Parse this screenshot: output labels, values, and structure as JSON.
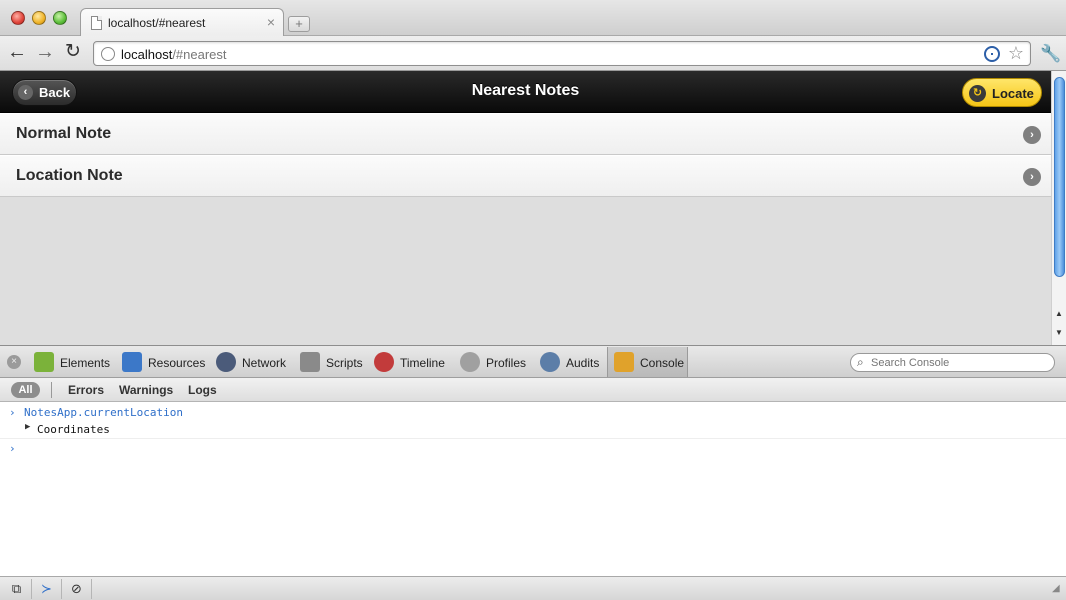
{
  "browser": {
    "tab_title": "localhost/#nearest",
    "tab_close": "×",
    "new_tab": "+",
    "url_host": "localhost",
    "url_path": "/#nearest"
  },
  "app": {
    "back_label": "Back",
    "title": "Nearest Notes",
    "locate_label": "Locate",
    "notes": [
      {
        "label": "Normal Note"
      },
      {
        "label": "Location Note"
      }
    ]
  },
  "devtools": {
    "tabs": [
      {
        "label": "Elements",
        "color": "#7bb23a"
      },
      {
        "label": "Resources",
        "color": "#3c78c8"
      },
      {
        "label": "Network",
        "color": "#4b5b7a"
      },
      {
        "label": "Scripts",
        "color": "#8a8a8a"
      },
      {
        "label": "Timeline",
        "color": "#c23b3b"
      },
      {
        "label": "Profiles",
        "color": "#a0a0a0"
      },
      {
        "label": "Audits",
        "color": "#5c7ea8"
      },
      {
        "label": "Console",
        "color": "#e0a22b"
      }
    ],
    "search_placeholder": "Search Console",
    "filters": {
      "all": "All",
      "errors": "Errors",
      "warnings": "Warnings",
      "logs": "Logs"
    },
    "console": {
      "command": "NotesApp.currentLocation",
      "result": "Coordinates",
      "prompt": "›"
    }
  }
}
